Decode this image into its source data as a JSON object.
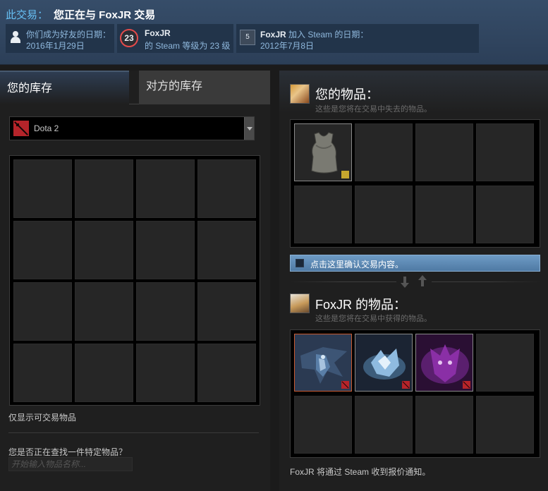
{
  "header": {
    "trade_label": "此交易：",
    "trade_title": "您正在与 FoxJR 交易",
    "friends_since_label": "你们成为好友的日期：",
    "friends_since_value": "2016年1月29日",
    "partner_name": "FoxJR",
    "steam_level_text": "的 Steam 等级为 23 级",
    "steam_level": "23",
    "join_name": "FoxJR",
    "join_text": " 加入 Steam 的日期：",
    "join_date": "2012年7月8日",
    "steam_badge": "5"
  },
  "left": {
    "tab_yours": "您的库存",
    "tab_theirs": "对方的库存",
    "game_selected": "Dota 2",
    "tradable_only": "仅显示可交易物品",
    "search_label": "您是否正在查找一件特定物品？",
    "search_placeholder": "开始输入物品名称..."
  },
  "right": {
    "your_items_title": "您的物品：",
    "your_items_sub": "这些是您将在交易中失去的物品。",
    "confirm_text": "点击这里确认交易内容。",
    "their_items_title": "FoxJR 的物品：",
    "their_items_sub": "这些是您将在交易中获得的物品。",
    "notify_text": "FoxJR 将通过 Steam 收到报价通知。"
  },
  "colors": {
    "accent": "#67c1f5",
    "header_bg": "#364d69",
    "confirm_bar": "#5d89b4",
    "level_ring": "#e34b4b"
  },
  "icons": [
    "person-icon",
    "steam-level-badge",
    "steam-years-badge",
    "dota2-icon",
    "dropdown-arrow-icon",
    "trade-arrow-down-icon",
    "trade-arrow-up-icon"
  ]
}
